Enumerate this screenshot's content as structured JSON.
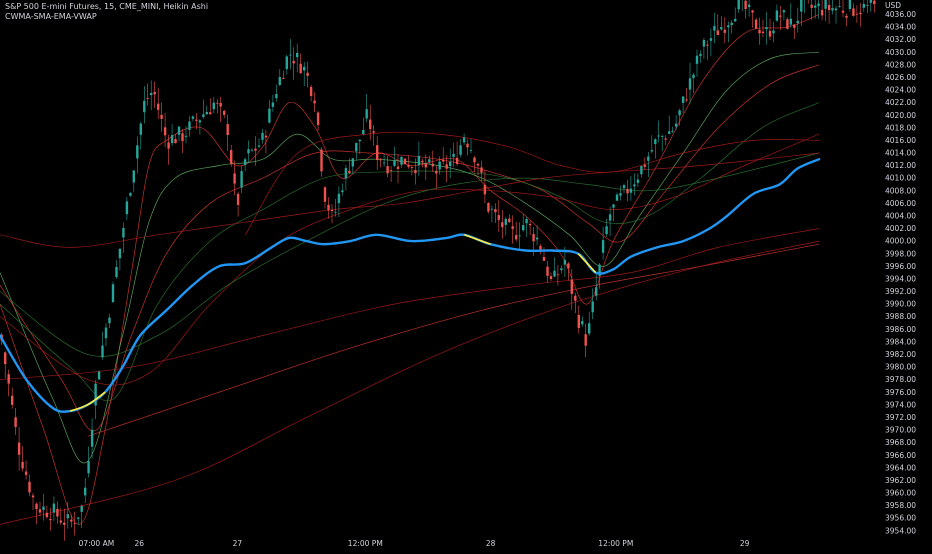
{
  "header": {
    "title": "S&P 500 E-mini Futures, 15, CME_MINI, Heikin Ashi",
    "indicator": "CWMA-SMA-EMA-VWAP",
    "currency": "USD"
  },
  "colors": {
    "background": "#000000",
    "candle_up": "#26a69a",
    "candle_down": "#ef5350",
    "main_ma": "#2196f3",
    "main_ma_alt": "#ffeb3b",
    "ma_red": "#e53935",
    "ma_dark_red": "#b71c1c",
    "ma_green": "#66bb6a",
    "ma_dark_green": "#2e7d32",
    "axis_text": "#d1d4dc"
  },
  "chart_data": {
    "type": "candlestick",
    "title": "S&P 500 E-mini Futures, 15, CME_MINI, Heikin Ashi",
    "xlabel": "",
    "ylabel": "",
    "ylim": [
      3953,
      4037.5
    ],
    "y_ticks": [
      4036,
      4034,
      4032,
      4030,
      4028,
      4026,
      4024,
      4022,
      4020,
      4018,
      4016,
      4014,
      4012,
      4010,
      4008,
      4006,
      4004,
      4002,
      4000,
      3998,
      3996,
      3994,
      3992,
      3990,
      3988,
      3986,
      3984,
      3982,
      3980,
      3978,
      3976,
      3974,
      3972,
      3970,
      3968,
      3966,
      3964,
      3962,
      3960,
      3958,
      3956,
      3954
    ],
    "x_ticks": [
      {
        "label": "07:00 AM",
        "index": 0.11
      },
      {
        "label": "26",
        "index": 0.159
      },
      {
        "label": "27",
        "index": 0.271
      },
      {
        "label": "12:00 PM",
        "index": 0.417
      },
      {
        "label": "28",
        "index": 0.56
      },
      {
        "label": "12:00 PM",
        "index": 0.703
      },
      {
        "label": "29",
        "index": 0.85
      }
    ],
    "price_path": [
      [
        0.0,
        3986
      ],
      [
        0.02,
        3968
      ],
      [
        0.04,
        3958
      ],
      [
        0.06,
        3957
      ],
      [
        0.08,
        3955
      ],
      [
        0.095,
        3958
      ],
      [
        0.11,
        3978
      ],
      [
        0.13,
        3993
      ],
      [
        0.15,
        4010
      ],
      [
        0.165,
        4022
      ],
      [
        0.175,
        4024
      ],
      [
        0.19,
        4016
      ],
      [
        0.21,
        4017
      ],
      [
        0.23,
        4020
      ],
      [
        0.245,
        4022
      ],
      [
        0.26,
        4018
      ],
      [
        0.27,
        4005
      ],
      [
        0.28,
        4013
      ],
      [
        0.3,
        4016
      ],
      [
        0.315,
        4024
      ],
      [
        0.33,
        4030
      ],
      [
        0.345,
        4028
      ],
      [
        0.36,
        4023
      ],
      [
        0.37,
        4008
      ],
      [
        0.38,
        4003
      ],
      [
        0.39,
        4009
      ],
      [
        0.41,
        4016
      ],
      [
        0.42,
        4020
      ],
      [
        0.43,
        4014
      ],
      [
        0.445,
        4012
      ],
      [
        0.46,
        4013
      ],
      [
        0.48,
        4012
      ],
      [
        0.5,
        4011
      ],
      [
        0.52,
        4013
      ],
      [
        0.53,
        4017
      ],
      [
        0.545,
        4013
      ],
      [
        0.555,
        4006
      ],
      [
        0.57,
        4003
      ],
      [
        0.585,
        4001
      ],
      [
        0.6,
        4003
      ],
      [
        0.615,
        4000
      ],
      [
        0.63,
        3993
      ],
      [
        0.645,
        3997
      ],
      [
        0.66,
        3988
      ],
      [
        0.67,
        3984
      ],
      [
        0.68,
        3992
      ],
      [
        0.695,
        4004
      ],
      [
        0.71,
        4007
      ],
      [
        0.73,
        4011
      ],
      [
        0.75,
        4016
      ],
      [
        0.77,
        4018
      ],
      [
        0.785,
        4024
      ],
      [
        0.8,
        4030
      ],
      [
        0.815,
        4033
      ],
      [
        0.83,
        4035
      ],
      [
        0.845,
        4038
      ],
      [
        0.86,
        4035
      ],
      [
        0.875,
        4033
      ],
      [
        0.89,
        4036
      ],
      [
        0.905,
        4034
      ],
      [
        0.915,
        4037
      ]
    ],
    "series": [
      {
        "role": "main",
        "values": [
          [
            0.0,
            3985
          ],
          [
            0.03,
            3978
          ],
          [
            0.06,
            3973.5
          ],
          [
            0.08,
            3973
          ],
          [
            0.1,
            3974
          ],
          [
            0.12,
            3976
          ],
          [
            0.14,
            3980
          ],
          [
            0.16,
            3985
          ],
          [
            0.19,
            3989
          ],
          [
            0.22,
            3993
          ],
          [
            0.25,
            3996
          ],
          [
            0.28,
            3996.5
          ],
          [
            0.31,
            3999
          ],
          [
            0.33,
            4000.5
          ],
          [
            0.35,
            4000
          ],
          [
            0.37,
            3999.5
          ],
          [
            0.4,
            4000
          ],
          [
            0.43,
            4001
          ],
          [
            0.47,
            4000
          ],
          [
            0.51,
            4000.5
          ],
          [
            0.53,
            4001
          ],
          [
            0.56,
            3999.5
          ],
          [
            0.6,
            3998.5
          ],
          [
            0.63,
            3998.5
          ],
          [
            0.66,
            3998
          ],
          [
            0.68,
            3995
          ],
          [
            0.7,
            3995.5
          ],
          [
            0.72,
            3997.5
          ],
          [
            0.75,
            3999
          ],
          [
            0.78,
            4000
          ],
          [
            0.81,
            4002
          ],
          [
            0.83,
            4004
          ],
          [
            0.86,
            4007.5
          ],
          [
            0.89,
            4009
          ],
          [
            0.91,
            4011.5
          ],
          [
            0.935,
            4013
          ]
        ]
      },
      {
        "role": "fast-red",
        "values": [
          [
            0.0,
            3990
          ],
          [
            0.05,
            3970
          ],
          [
            0.09,
            3955
          ],
          [
            0.12,
            3970
          ],
          [
            0.15,
            3995
          ],
          [
            0.17,
            4012
          ],
          [
            0.19,
            4016
          ],
          [
            0.23,
            4018
          ],
          [
            0.27,
            4012
          ],
          [
            0.3,
            4015
          ],
          [
            0.33,
            4022
          ],
          [
            0.36,
            4018
          ],
          [
            0.39,
            4010
          ],
          [
            0.43,
            4014
          ],
          [
            0.47,
            4012
          ],
          [
            0.52,
            4013
          ],
          [
            0.56,
            4008
          ],
          [
            0.6,
            4004
          ],
          [
            0.64,
            3998
          ],
          [
            0.67,
            3990
          ],
          [
            0.7,
            4000
          ],
          [
            0.75,
            4012
          ],
          [
            0.8,
            4025
          ],
          [
            0.85,
            4033
          ],
          [
            0.9,
            4034
          ],
          [
            0.935,
            4036
          ]
        ]
      },
      {
        "role": "green-1",
        "values": [
          [
            0.0,
            3995
          ],
          [
            0.06,
            3975
          ],
          [
            0.1,
            3965
          ],
          [
            0.14,
            3985
          ],
          [
            0.17,
            4003
          ],
          [
            0.2,
            4010
          ],
          [
            0.25,
            4012
          ],
          [
            0.3,
            4013
          ],
          [
            0.34,
            4017
          ],
          [
            0.38,
            4013
          ],
          [
            0.43,
            4013
          ],
          [
            0.5,
            4012
          ],
          [
            0.55,
            4010
          ],
          [
            0.6,
            4006
          ],
          [
            0.65,
            4001
          ],
          [
            0.69,
            3996
          ],
          [
            0.73,
            4004
          ],
          [
            0.78,
            4014
          ],
          [
            0.83,
            4024
          ],
          [
            0.88,
            4029
          ],
          [
            0.935,
            4030
          ]
        ]
      },
      {
        "role": "red-2",
        "values": [
          [
            0.0,
            3993
          ],
          [
            0.07,
            3978
          ],
          [
            0.11,
            3970
          ],
          [
            0.15,
            3985
          ],
          [
            0.19,
            3998
          ],
          [
            0.24,
            4006
          ],
          [
            0.3,
            4010
          ],
          [
            0.36,
            4014
          ],
          [
            0.42,
            4014
          ],
          [
            0.5,
            4013
          ],
          [
            0.56,
            4011
          ],
          [
            0.62,
            4008
          ],
          [
            0.67,
            4003
          ],
          [
            0.71,
            4000
          ],
          [
            0.76,
            4008
          ],
          [
            0.82,
            4018
          ],
          [
            0.88,
            4025
          ],
          [
            0.935,
            4028
          ]
        ]
      },
      {
        "role": "green-2",
        "values": [
          [
            0.0,
            3990
          ],
          [
            0.08,
            3980
          ],
          [
            0.13,
            3975
          ],
          [
            0.18,
            3990
          ],
          [
            0.24,
            4000
          ],
          [
            0.3,
            4005
          ],
          [
            0.37,
            4010
          ],
          [
            0.44,
            4011
          ],
          [
            0.52,
            4011
          ],
          [
            0.58,
            4010
          ],
          [
            0.64,
            4007
          ],
          [
            0.69,
            4003
          ],
          [
            0.74,
            4004
          ],
          [
            0.8,
            4010
          ],
          [
            0.87,
            4018
          ],
          [
            0.935,
            4022
          ]
        ]
      },
      {
        "role": "red-3",
        "values": [
          [
            0.0,
            3988
          ],
          [
            0.1,
            3978
          ],
          [
            0.17,
            3979
          ],
          [
            0.24,
            3990
          ],
          [
            0.32,
            4000
          ],
          [
            0.4,
            4005
          ],
          [
            0.48,
            4008
          ],
          [
            0.56,
            4008
          ],
          [
            0.63,
            4007
          ],
          [
            0.7,
            4005
          ],
          [
            0.77,
            4007
          ],
          [
            0.85,
            4012
          ],
          [
            0.935,
            4017
          ]
        ]
      },
      {
        "role": "green-3",
        "values": [
          [
            0.0,
            3992
          ],
          [
            0.1,
            3982
          ],
          [
            0.18,
            3985
          ],
          [
            0.26,
            3993
          ],
          [
            0.35,
            4000
          ],
          [
            0.44,
            4006
          ],
          [
            0.52,
            4009
          ],
          [
            0.6,
            4010
          ],
          [
            0.67,
            4009
          ],
          [
            0.74,
            4008
          ],
          [
            0.82,
            4010
          ],
          [
            0.935,
            4014
          ]
        ]
      },
      {
        "role": "slow-red",
        "values": [
          [
            0.0,
            4001
          ],
          [
            0.08,
            3999
          ],
          [
            0.18,
            4001
          ],
          [
            0.28,
            4003
          ],
          [
            0.38,
            4005
          ],
          [
            0.46,
            4006
          ],
          [
            0.54,
            4008
          ],
          [
            0.62,
            4010
          ],
          [
            0.7,
            4011
          ],
          [
            0.8,
            4012
          ],
          [
            0.935,
            4014
          ]
        ]
      },
      {
        "role": "band-top",
        "values": [
          [
            0.28,
            4001
          ],
          [
            0.34,
            4014
          ],
          [
            0.42,
            4017
          ],
          [
            0.5,
            4017
          ],
          [
            0.58,
            4015
          ],
          [
            0.64,
            4012
          ],
          [
            0.7,
            4011
          ],
          [
            0.78,
            4014
          ],
          [
            0.86,
            4016
          ],
          [
            0.935,
            4016
          ]
        ]
      },
      {
        "role": "long-red-1",
        "values": [
          [
            0.0,
            3978
          ],
          [
            0.15,
            3980
          ],
          [
            0.3,
            3985
          ],
          [
            0.45,
            3990
          ],
          [
            0.6,
            3993
          ],
          [
            0.72,
            3995
          ],
          [
            0.82,
            3999
          ],
          [
            0.935,
            4002
          ]
        ]
      },
      {
        "role": "long-red-2",
        "values": [
          [
            0.1,
            3969
          ],
          [
            0.25,
            3976
          ],
          [
            0.4,
            3983
          ],
          [
            0.55,
            3989
          ],
          [
            0.68,
            3993
          ],
          [
            0.8,
            3996
          ],
          [
            0.935,
            3999.5
          ]
        ]
      },
      {
        "role": "long-red-3",
        "values": [
          [
            0.0,
            3955
          ],
          [
            0.2,
            3962
          ],
          [
            0.35,
            3972
          ],
          [
            0.5,
            3982
          ],
          [
            0.65,
            3990
          ],
          [
            0.8,
            3996
          ],
          [
            0.935,
            4000
          ]
        ]
      }
    ]
  }
}
